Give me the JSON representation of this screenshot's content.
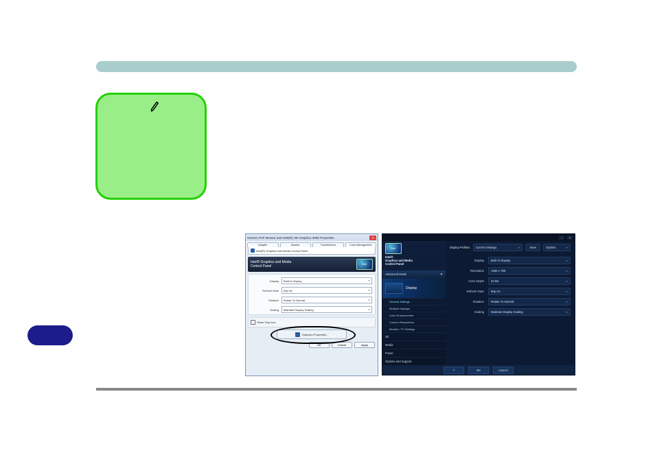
{
  "winDialog": {
    "title": "Generic PnP Monitor and Intel(R) HD Graphics 3000 Properties",
    "tabs": [
      "Adapter",
      "Monitor",
      "Troubleshoot",
      "Color Management"
    ],
    "subtab": "Intel(R) Graphics and Media Control Panel",
    "headerLine1": "Intel® Graphics and Media",
    "headerLine2": "Control Panel",
    "intelBadge": "intel",
    "fields": {
      "displayLabel": "Display",
      "displayValue": "Built-in Display",
      "refreshLabel": "Refresh Rate",
      "refreshValue": "60p Hz",
      "rotationLabel": "Rotation",
      "rotationValue": "Rotate To Normal",
      "scalingLabel": "Scaling",
      "scalingValue": "Maintain Display Scaling"
    },
    "showTrayIcon": "Show Tray Icon",
    "graphicsPropsBtn": "Graphics Properties...",
    "ok": "OK",
    "cancel": "Cancel",
    "apply": "Apply"
  },
  "icp": {
    "titleLine1": "Intel®",
    "titleLine2": "Graphics and Media",
    "titleLine3": "Control Panel",
    "advancedMode": "Advanced Mode",
    "advArrow": "▼",
    "sidebar": {
      "display": "Display",
      "subItems": [
        "General Settings",
        "Multiple Displays",
        "Color Enhancement",
        "Custom Resolutions",
        "Monitor / TV Settings"
      ],
      "threeD": "3D",
      "media": "Media",
      "power": "Power",
      "options": "Options and Support"
    },
    "topRow": {
      "profileLabel": "Display Profiles:",
      "profileValue": "Current Settings",
      "save": "Save",
      "options": "Options"
    },
    "form": {
      "displayLabel": "Display",
      "displayValue": "Built-in Display",
      "resolutionLabel": "Resolution",
      "resolutionValue": "1366 x 768",
      "colorDepthLabel": "Color Depth",
      "colorDepthValue": "32 Bit",
      "refreshLabel": "Refresh Rate",
      "refreshValue": "60p Hz",
      "rotationLabel": "Rotation",
      "rotationValue": "Rotate To Normal",
      "scalingLabel": "Scaling",
      "scalingValue": "Maintain Display Scaling"
    },
    "bottom": {
      "ok": "OK",
      "cancel": "Cancel",
      "help": "?"
    },
    "intelBadge": "intel"
  }
}
